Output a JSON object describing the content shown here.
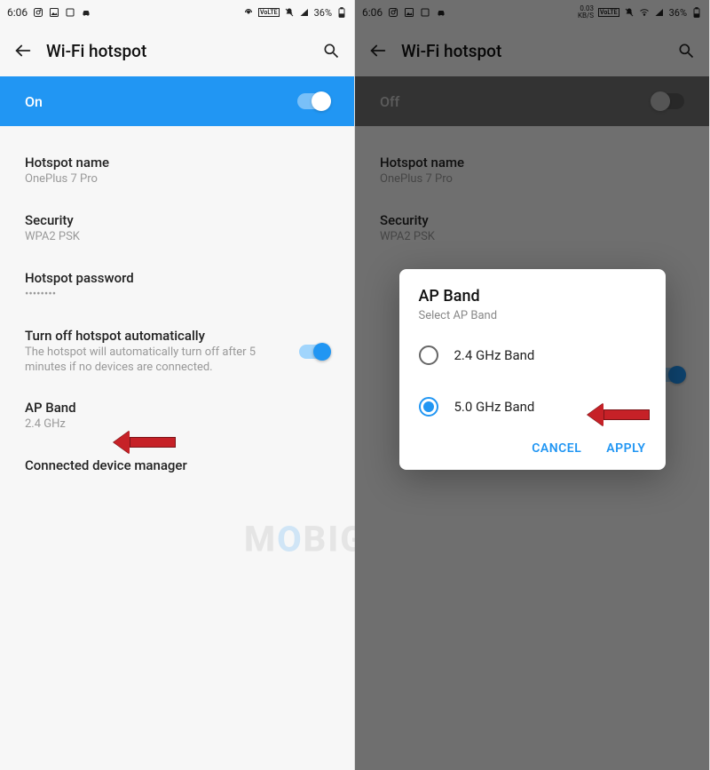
{
  "left": {
    "statusbar": {
      "time": "6:06",
      "battery": "36%"
    },
    "header": {
      "title": "Wi-Fi hotspot"
    },
    "toggle": {
      "label": "On",
      "state": "on"
    },
    "settings": {
      "hotspot_name": {
        "title": "Hotspot name",
        "value": "OnePlus 7 Pro"
      },
      "security": {
        "title": "Security",
        "value": "WPA2 PSK"
      },
      "password": {
        "title": "Hotspot password",
        "value": "••••••••"
      },
      "auto_off": {
        "title": "Turn off hotspot automatically",
        "desc": "The hotspot will automatically turn off after 5 minutes if no devices are connected."
      },
      "ap_band": {
        "title": "AP Band",
        "value": "2.4 GHz"
      },
      "devices": {
        "title": "Connected device manager"
      }
    }
  },
  "right": {
    "statusbar": {
      "time": "6:06",
      "speed": "0.03",
      "speed_unit": "KB/S",
      "battery": "36%"
    },
    "header": {
      "title": "Wi-Fi hotspot"
    },
    "toggle": {
      "label": "Off",
      "state": "off"
    },
    "settings": {
      "hotspot_name": {
        "title": "Hotspot name",
        "value": "OnePlus 7 Pro"
      },
      "security": {
        "title": "Security",
        "value": "WPA2 PSK"
      }
    },
    "dialog": {
      "title": "AP Band",
      "subtitle": "Select AP Band",
      "options": [
        {
          "label": "2.4 GHz Band",
          "selected": false
        },
        {
          "label": "5.0 GHz Band",
          "selected": true
        }
      ],
      "cancel": "CANCEL",
      "apply": "APPLY"
    }
  },
  "watermark": "MOBIGYAAN"
}
